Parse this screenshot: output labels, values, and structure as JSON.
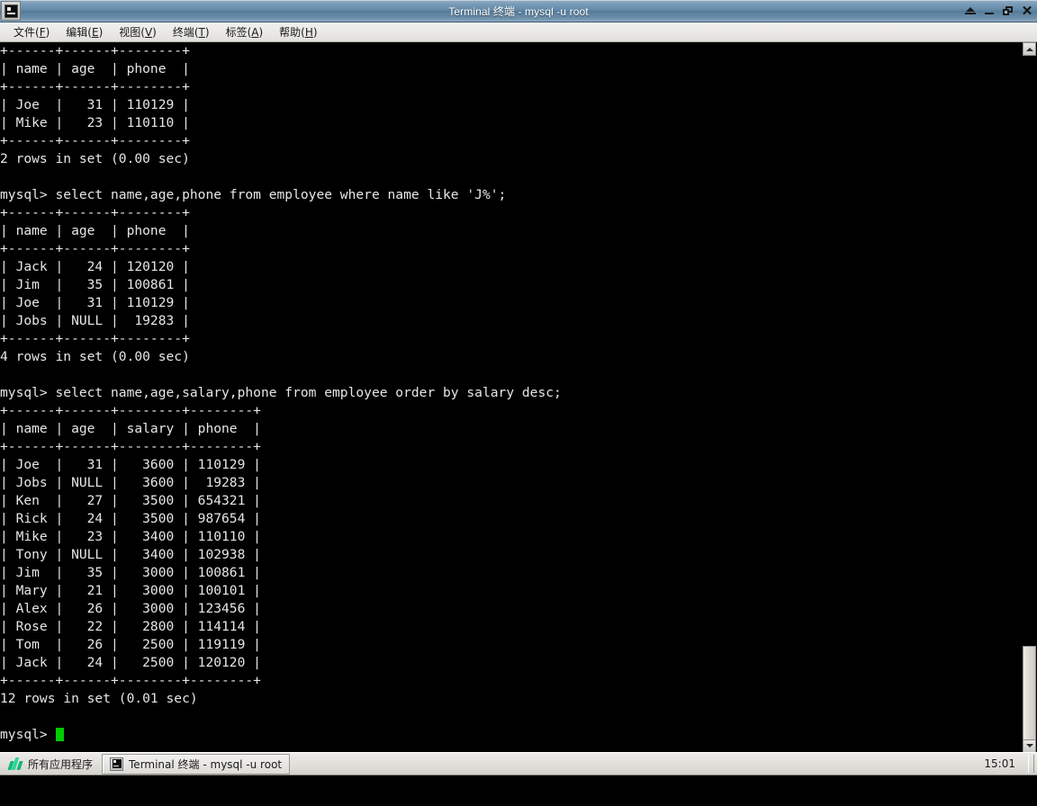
{
  "window": {
    "title": "Terminal 终端 - mysql -u root",
    "icon": "terminal-icon",
    "buttons": {
      "shade": "shade",
      "minimize": "minimize",
      "maximize": "maximize",
      "close": "close"
    }
  },
  "menubar": {
    "items": [
      {
        "label": "文件(F)",
        "pre": "文件(",
        "accel": "F",
        "post": ")"
      },
      {
        "label": "编辑(E)",
        "pre": "编辑(",
        "accel": "E",
        "post": ")"
      },
      {
        "label": "视图(V)",
        "pre": "视图(",
        "accel": "V",
        "post": ")"
      },
      {
        "label": "终端(T)",
        "pre": "终端(",
        "accel": "T",
        "post": ")"
      },
      {
        "label": "标签(A)",
        "pre": "标签(",
        "accel": "A",
        "post": ")"
      },
      {
        "label": "帮助(H)",
        "pre": "帮助(",
        "accel": "H",
        "post": ")"
      }
    ]
  },
  "terminal": {
    "prompt": "mysql> ",
    "cursor": "block",
    "lines": [
      "+------+------+--------+",
      "| name | age  | phone  |",
      "+------+------+--------+",
      "| Joe  |   31 | 110129 |",
      "| Mike |   23 | 110110 |",
      "+------+------+--------+",
      "2 rows in set (0.00 sec)",
      "",
      "mysql> select name,age,phone from employee where name like 'J%';",
      "+------+------+--------+",
      "| name | age  | phone  |",
      "+------+------+--------+",
      "| Jack |   24 | 120120 |",
      "| Jim  |   35 | 100861 |",
      "| Joe  |   31 | 110129 |",
      "| Jobs | NULL |  19283 |",
      "+------+------+--------+",
      "4 rows in set (0.00 sec)",
      "",
      "mysql> select name,age,salary,phone from employee order by salary desc;",
      "+------+------+--------+--------+",
      "| name | age  | salary | phone  |",
      "+------+------+--------+--------+",
      "| Joe  |   31 |   3600 | 110129 |",
      "| Jobs | NULL |   3600 |  19283 |",
      "| Ken  |   27 |   3500 | 654321 |",
      "| Rick |   24 |   3500 | 987654 |",
      "| Mike |   23 |   3400 | 110110 |",
      "| Tony | NULL |   3400 | 102938 |",
      "| Jim  |   35 |   3000 | 100861 |",
      "| Mary |   21 |   3000 | 100101 |",
      "| Alex |   26 |   3000 | 123456 |",
      "| Rose |   22 |   2800 | 114114 |",
      "| Tom  |   26 |   2500 | 119119 |",
      "| Jack |   24 |   2500 | 120120 |",
      "+------+------+--------+--------+",
      "12 rows in set (0.01 sec)",
      ""
    ],
    "queries": [
      "select name,age,phone from employee where name like 'J%';",
      "select name,age,salary,phone from employee order by salary desc;"
    ],
    "results": [
      {
        "columns": [
          "name",
          "age",
          "phone"
        ],
        "rows": [
          [
            "Joe",
            "31",
            "110129"
          ],
          [
            "Mike",
            "23",
            "110110"
          ]
        ],
        "status": "2 rows in set (0.00 sec)"
      },
      {
        "columns": [
          "name",
          "age",
          "phone"
        ],
        "rows": [
          [
            "Jack",
            "24",
            "120120"
          ],
          [
            "Jim",
            "35",
            "100861"
          ],
          [
            "Joe",
            "31",
            "110129"
          ],
          [
            "Jobs",
            "NULL",
            "19283"
          ]
        ],
        "status": "4 rows in set (0.00 sec)"
      },
      {
        "columns": [
          "name",
          "age",
          "salary",
          "phone"
        ],
        "rows": [
          [
            "Joe",
            "31",
            "3600",
            "110129"
          ],
          [
            "Jobs",
            "NULL",
            "3600",
            "19283"
          ],
          [
            "Ken",
            "27",
            "3500",
            "654321"
          ],
          [
            "Rick",
            "24",
            "3500",
            "987654"
          ],
          [
            "Mike",
            "23",
            "3400",
            "110110"
          ],
          [
            "Tony",
            "NULL",
            "3400",
            "102938"
          ],
          [
            "Jim",
            "35",
            "3000",
            "100861"
          ],
          [
            "Mary",
            "21",
            "3000",
            "100101"
          ],
          [
            "Alex",
            "26",
            "3000",
            "123456"
          ],
          [
            "Rose",
            "22",
            "2800",
            "114114"
          ],
          [
            "Tom",
            "26",
            "2500",
            "119119"
          ],
          [
            "Jack",
            "24",
            "2500",
            "120120"
          ]
        ],
        "status": "12 rows in set (0.01 sec)"
      }
    ]
  },
  "taskbar": {
    "apps_button_label": "所有应用程序",
    "apps_icon": "applications-icon",
    "windows": [
      {
        "label": "Terminal 终端 - mysql -u root",
        "icon": "terminal-icon"
      }
    ],
    "clock": "15:01"
  },
  "colors": {
    "terminal_bg": "#000000",
    "terminal_fg": "#e6e6e6",
    "cursor": "#00cc00",
    "titlebar": "#5f87a5",
    "chrome": "#e2e0db",
    "accent_green": "#1ec98b"
  }
}
